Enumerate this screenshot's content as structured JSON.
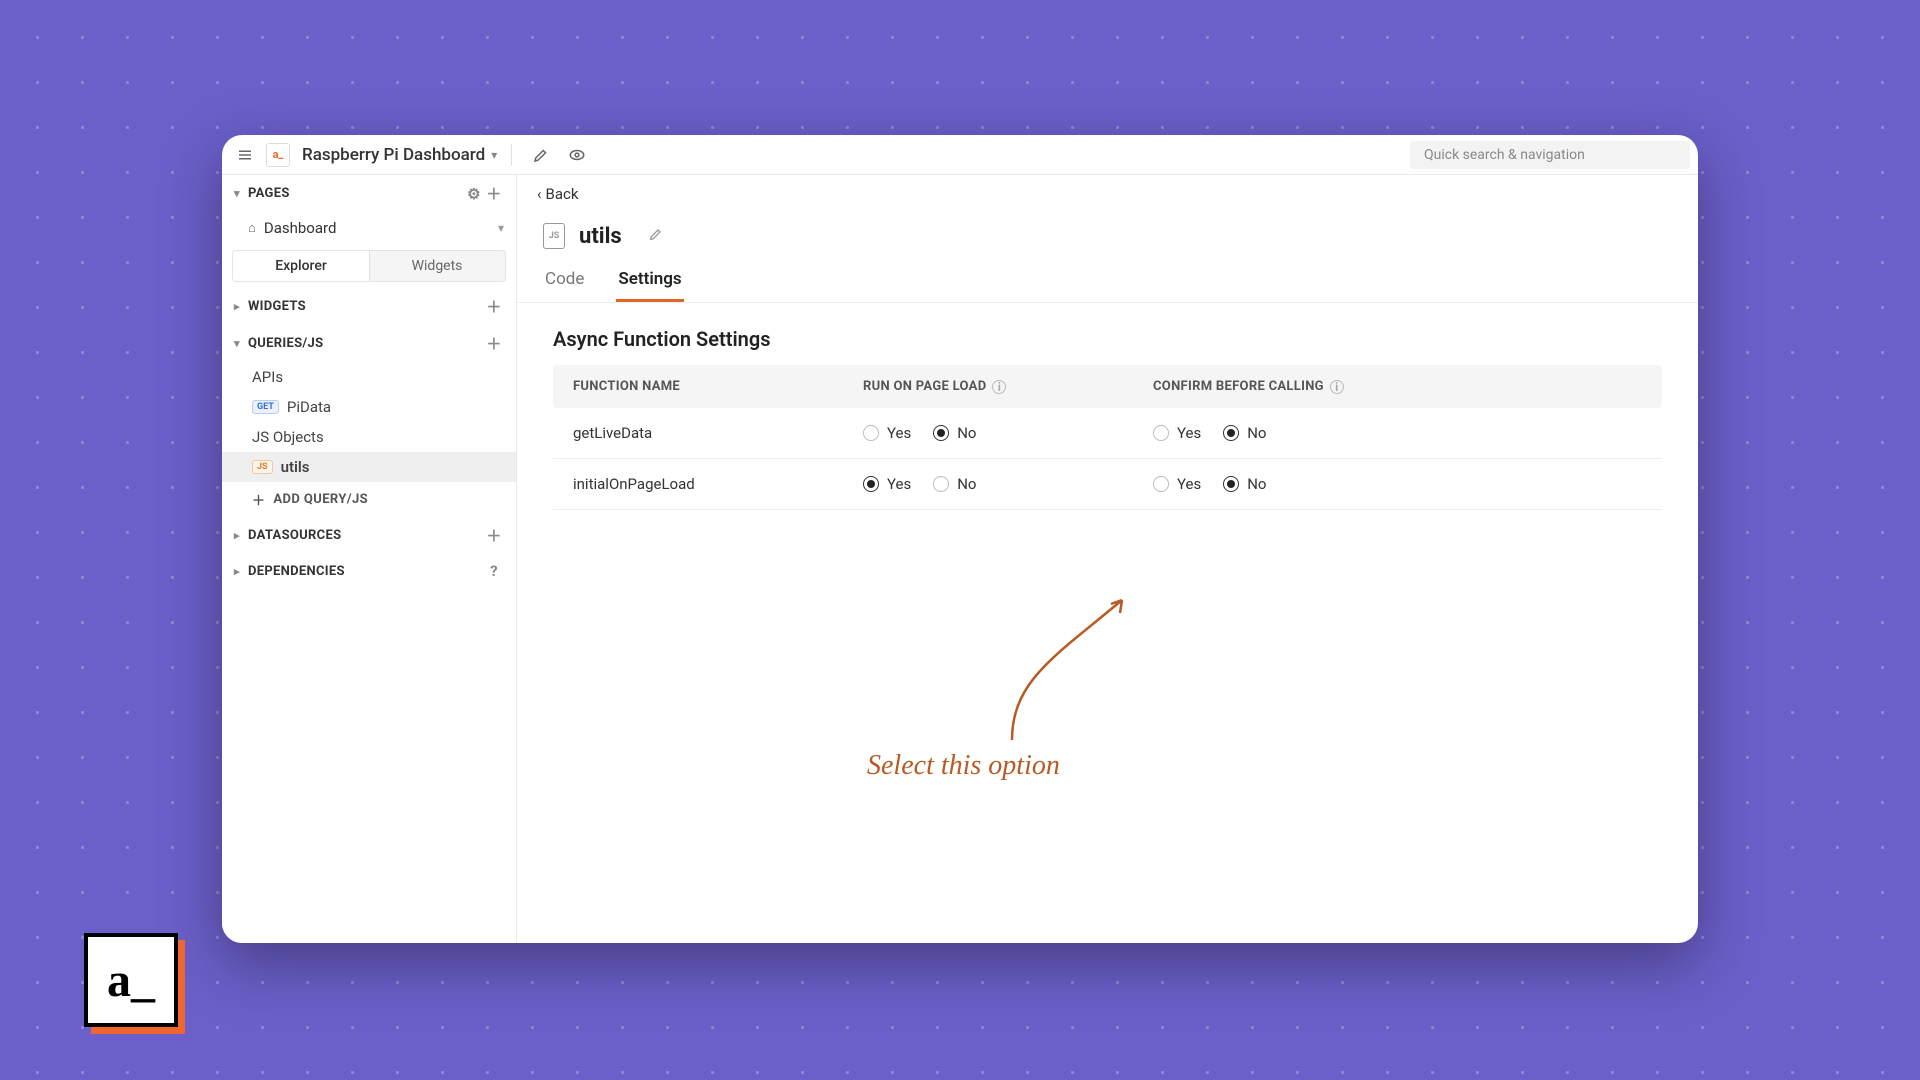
{
  "topbar": {
    "app_title": "Raspberry Pi Dashboard",
    "search_placeholder": "Quick search & navigation"
  },
  "sidebar": {
    "pages_label": "PAGES",
    "dashboard_label": "Dashboard",
    "explorer_label": "Explorer",
    "widgets_toggle_label": "Widgets",
    "widgets_section": "WIDGETS",
    "queries_section": "QUERIES/JS",
    "apis_label": "APIs",
    "pidata_label": "PiData",
    "jsobjects_label": "JS Objects",
    "utils_label": "utils",
    "add_query_label": "ADD QUERY/JS",
    "datasources_section": "DATASOURCES",
    "dependencies_section": "DEPENDENCIES"
  },
  "main": {
    "back_label": "Back",
    "file_name": "utils",
    "tab_code": "Code",
    "tab_settings": "Settings",
    "panel_title": "Async Function Settings",
    "columns": {
      "name": "FUNCTION NAME",
      "run": "RUN ON PAGE LOAD",
      "confirm": "CONFIRM BEFORE CALLING"
    },
    "yes": "Yes",
    "no": "No",
    "rows": [
      {
        "name": "getLiveData",
        "run_yes": false,
        "confirm_yes": false
      },
      {
        "name": "initialOnPageLoad",
        "run_yes": true,
        "confirm_yes": false
      }
    ]
  },
  "annotation": {
    "text": "Select this option"
  },
  "corner_logo": {
    "text": "a_"
  }
}
